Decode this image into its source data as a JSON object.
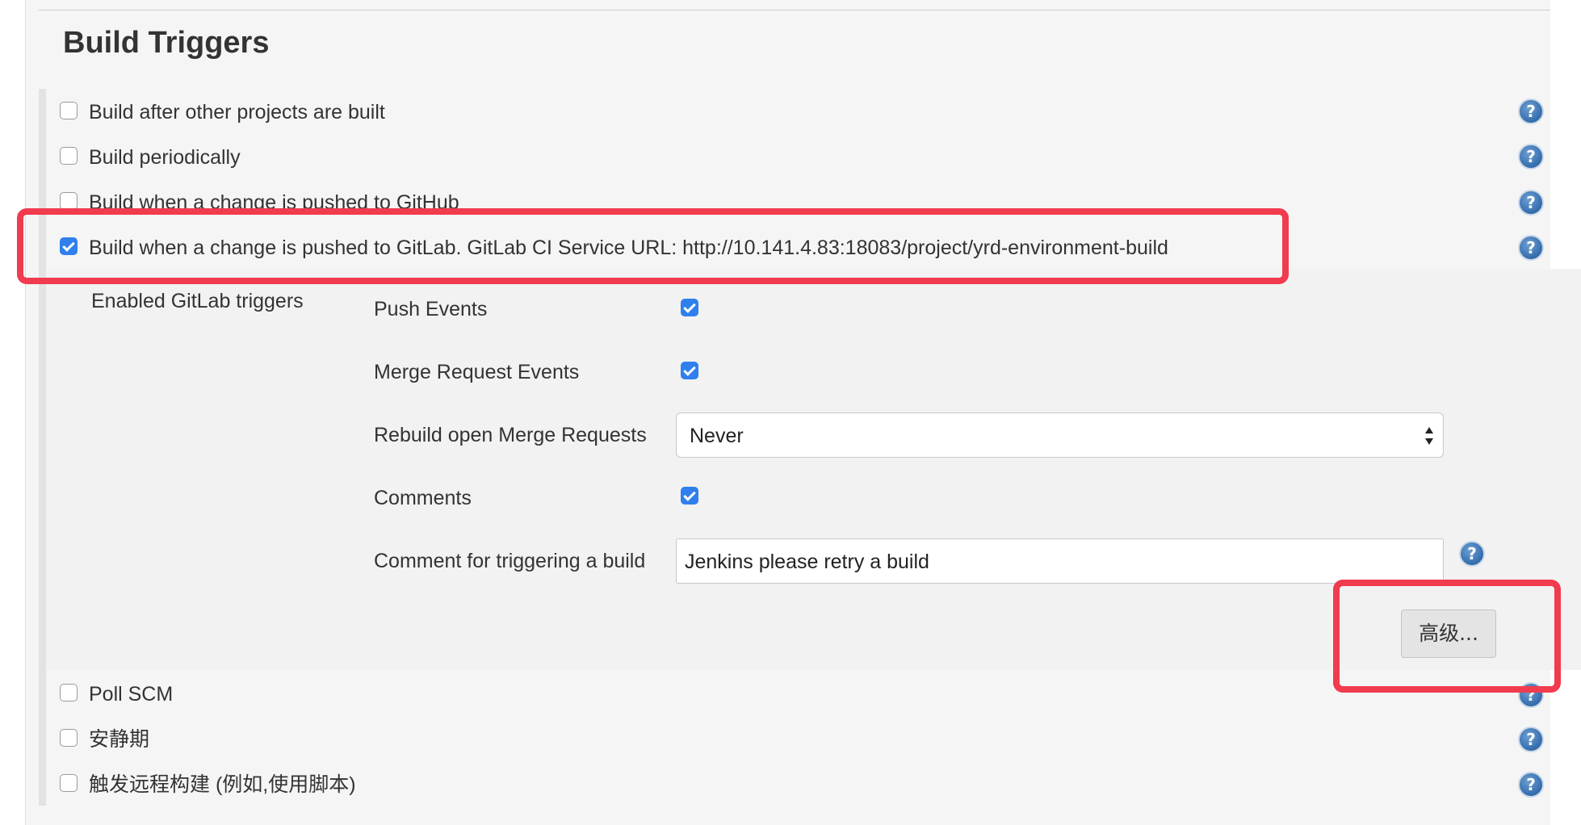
{
  "section": {
    "title": "Build Triggers"
  },
  "triggers": [
    {
      "label": "Build after other projects are built",
      "checked": false
    },
    {
      "label": "Build periodically",
      "checked": false
    },
    {
      "label": "Build when a change is pushed to GitHub",
      "checked": false
    },
    {
      "label": "Build when a change is pushed to GitLab. GitLab CI Service URL: http://10.141.4.83:18083/project/yrd-environment-build",
      "checked": true
    }
  ],
  "gitlab": {
    "section_label": "Enabled GitLab triggers",
    "push_events": {
      "label": "Push Events",
      "checked": true
    },
    "merge_request_events": {
      "label": "Merge Request Events",
      "checked": true
    },
    "rebuild_open_mr": {
      "label": "Rebuild open Merge Requests",
      "selected": "Never"
    },
    "comments": {
      "label": "Comments",
      "checked": true
    },
    "comment_trigger": {
      "label": "Comment for triggering a build",
      "value": "Jenkins please retry a build"
    },
    "advanced_button": "高级..."
  },
  "other_triggers": [
    {
      "label": "Poll SCM",
      "checked": false
    },
    {
      "label": "安静期",
      "checked": false
    },
    {
      "label": "触发远程构建 (例如,使用脚本)",
      "checked": false
    }
  ],
  "help_icon_glyph": "?",
  "colors": {
    "checkbox_checked": "#2f80ed",
    "highlight": "#f03c4e",
    "help_icon": "#3b73b3"
  }
}
